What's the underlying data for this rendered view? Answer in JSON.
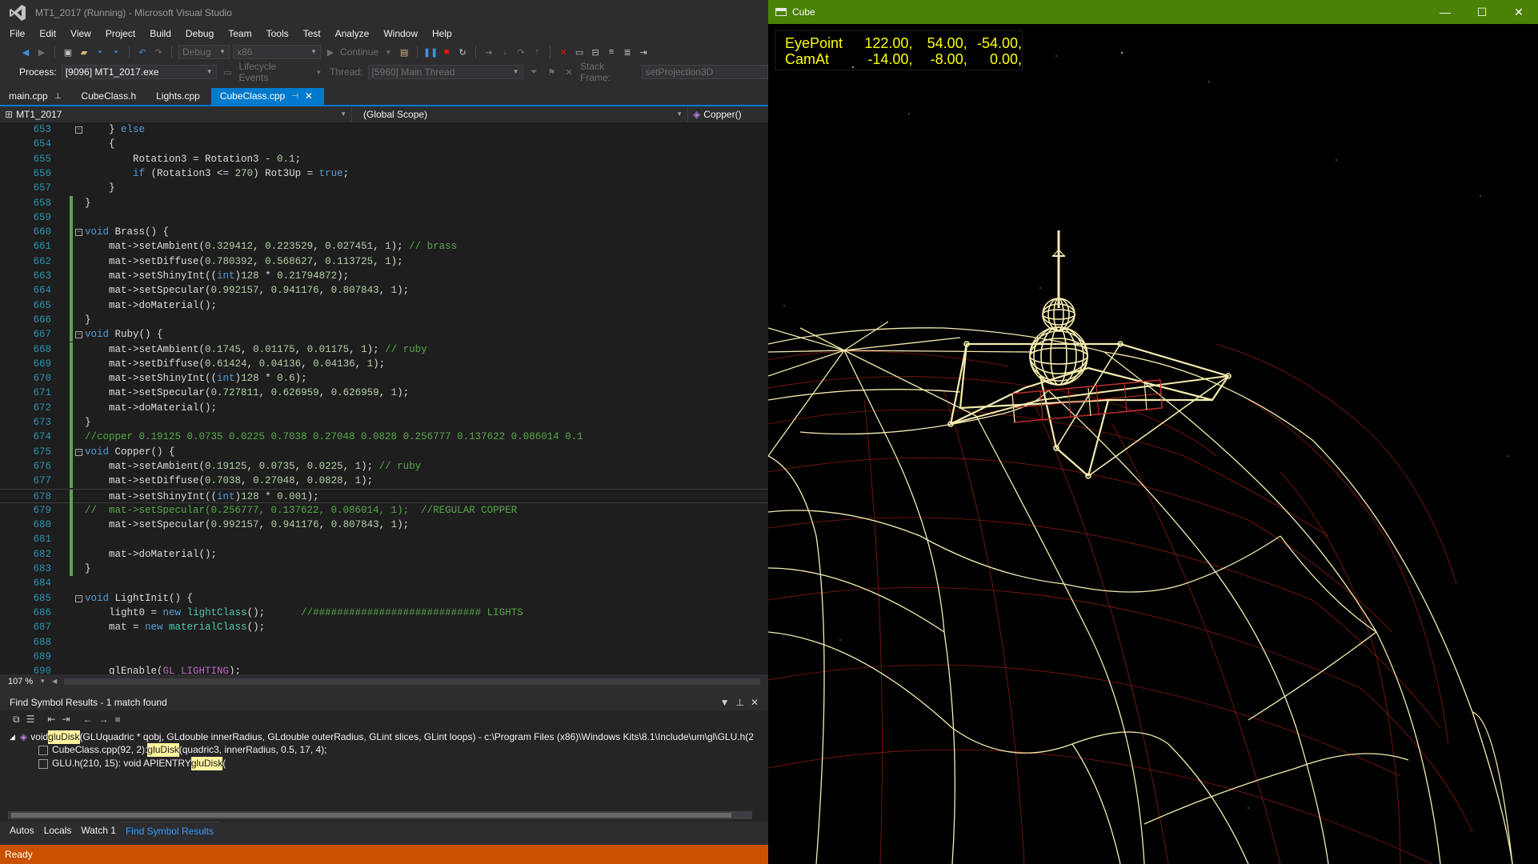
{
  "vs": {
    "window_title": "MT1_2017 (Running) - Microsoft Visual Studio",
    "menu": [
      "File",
      "Edit",
      "View",
      "Project",
      "Build",
      "Debug",
      "Team",
      "Tools",
      "Test",
      "Analyze",
      "Window",
      "Help"
    ],
    "toolbar": {
      "config": "Debug",
      "platform": "x86",
      "continue_label": "Continue"
    },
    "debugbar": {
      "process_label": "Process:",
      "process_value": "[9096] MT1_2017.exe",
      "lifecycle_label": "Lifecycle Events",
      "thread_label": "Thread:",
      "thread_value": "[5960] Main Thread",
      "stackframe_label": "Stack Frame:",
      "stackframe_value": "setProjection3D"
    },
    "tabs": [
      {
        "label": "main.cpp",
        "pinned": true
      },
      {
        "label": "CubeClass.h"
      },
      {
        "label": "Lights.cpp"
      },
      {
        "label": "CubeClass.cpp",
        "active": true,
        "pinned": true
      }
    ],
    "navbar": {
      "project": "MT1_2017",
      "scope": "(Global Scope)",
      "member": "Copper()"
    },
    "zoom": "107 %",
    "code_lines": [
      {
        "n": "653",
        "html": "    } <span class=\"kw\">else</span>"
      },
      {
        "n": "654",
        "html": "    {"
      },
      {
        "n": "655",
        "html": "        Rotation3 = Rotation3 - <span class=\"num\">0.1</span>;"
      },
      {
        "n": "656",
        "html": "        <span class=\"kw\">if</span> (Rotation3 &lt;= <span class=\"num\">270</span>) Rot3Up = <span class=\"kw\">true</span>;"
      },
      {
        "n": "657",
        "html": "    }"
      },
      {
        "n": "658",
        "html": "}"
      },
      {
        "n": "659",
        "html": ""
      },
      {
        "n": "660",
        "html": "<span class=\"kw\">void</span> Brass() {"
      },
      {
        "n": "661",
        "html": "    mat-&gt;setAmbient(<span class=\"num\">0.329412</span>, <span class=\"num\">0.223529</span>, <span class=\"num\">0.027451</span>, <span class=\"num\">1</span>); <span class=\"cm\">// brass</span>"
      },
      {
        "n": "662",
        "html": "    mat-&gt;setDiffuse(<span class=\"num\">0.780392</span>, <span class=\"num\">0.568627</span>, <span class=\"num\">0.113725</span>, <span class=\"num\">1</span>);"
      },
      {
        "n": "663",
        "html": "    mat-&gt;setShinyInt((<span class=\"kw\">int</span>)<span class=\"num\">128</span> * <span class=\"num\">0.21794872</span>);"
      },
      {
        "n": "664",
        "html": "    mat-&gt;setSpecular(<span class=\"num\">0.992157</span>, <span class=\"num\">0.941176</span>, <span class=\"num\">0.807843</span>, <span class=\"num\">1</span>);"
      },
      {
        "n": "665",
        "html": "    mat-&gt;doMaterial();"
      },
      {
        "n": "666",
        "html": "}"
      },
      {
        "n": "667",
        "html": "<span class=\"kw\">void</span> Ruby() {"
      },
      {
        "n": "668",
        "html": "    mat-&gt;setAmbient(<span class=\"num\">0.1745</span>, <span class=\"num\">0.01175</span>, <span class=\"num\">0.01175</span>, <span class=\"num\">1</span>); <span class=\"cm\">// ruby</span>"
      },
      {
        "n": "669",
        "html": "    mat-&gt;setDiffuse(<span class=\"num\">0.61424</span>, <span class=\"num\">0.04136</span>, <span class=\"num\">0.04136</span>, <span class=\"num\">1</span>);"
      },
      {
        "n": "670",
        "html": "    mat-&gt;setShinyInt((<span class=\"kw\">int</span>)<span class=\"num\">128</span> * <span class=\"num\">0.6</span>);"
      },
      {
        "n": "671",
        "html": "    mat-&gt;setSpecular(<span class=\"num\">0.727811</span>, <span class=\"num\">0.626959</span>, <span class=\"num\">0.626959</span>, <span class=\"num\">1</span>);"
      },
      {
        "n": "672",
        "html": "    mat-&gt;doMaterial();"
      },
      {
        "n": "673",
        "html": "}"
      },
      {
        "n": "674",
        "html": "<span class=\"cm\">//copper 0.19125 0.0735 0.0225 0.7038 0.27048 0.0828 0.256777 0.137622 0.086014 0.1</span>"
      },
      {
        "n": "675",
        "html": "<span class=\"kw\">void</span> Copper() {"
      },
      {
        "n": "676",
        "html": "    mat-&gt;setAmbient(<span class=\"num\">0.19125</span>, <span class=\"num\">0.0735</span>, <span class=\"num\">0.0225</span>, <span class=\"num\">1</span>); <span class=\"cm\">// ruby</span>"
      },
      {
        "n": "677",
        "html": "    mat-&gt;setDiffuse(<span class=\"num\">0.7038</span>, <span class=\"num\">0.27048</span>, <span class=\"num\">0.0828</span>, <span class=\"num\">1</span>);"
      },
      {
        "n": "678",
        "html": "    mat-&gt;setShinyInt((<span class=\"kw\">int</span>)<span class=\"num\">128</span> * <span class=\"num\">0.001</span>);"
      },
      {
        "n": "679",
        "html": "<span class=\"cm\">//  mat-&gt;setSpecular(0.256777, 0.137622, 0.086014, 1);  //REGULAR COPPER</span>"
      },
      {
        "n": "680",
        "html": "    mat-&gt;setSpecular(<span class=\"num\">0.992157</span>, <span class=\"num\">0.941176</span>, <span class=\"num\">0.807843</span>, <span class=\"num\">1</span>);"
      },
      {
        "n": "681",
        "html": ""
      },
      {
        "n": "682",
        "html": "    mat-&gt;doMaterial();"
      },
      {
        "n": "683",
        "html": "}"
      },
      {
        "n": "684",
        "html": ""
      },
      {
        "n": "685",
        "html": "<span class=\"kw\">void</span> LightInit() {"
      },
      {
        "n": "686",
        "html": "    light0 = <span class=\"kw\">new</span> <span class=\"ty\">lightClass</span>();      <span class=\"cm\">//############################ LIGHTS</span>"
      },
      {
        "n": "687",
        "html": "    mat = <span class=\"kw\">new</span> <span class=\"ty\">materialClass</span>();"
      },
      {
        "n": "688",
        "html": ""
      },
      {
        "n": "689",
        "html": ""
      },
      {
        "n": "690",
        "html": "    glEnable(<span class=\"mac\">GL_LIGHTING</span>);"
      }
    ],
    "find_panel": {
      "title": "Find Symbol Results - 1 match found",
      "row1_pre": "void ",
      "row1_hl": "gluDisk",
      "row1_post": "(GLUquadric * qobj, GLdouble innerRadius, GLdouble outerRadius, GLint slices, GLint loops) - c:\\Program Files (x86)\\Windows Kits\\8.1\\Include\\um\\gl\\GLU.h(2",
      "row2_pre": "CubeClass.cpp(92, 2): ",
      "row2_hl": "gluDisk",
      "row2_post": "(quadric3, innerRadius, 0.5, 17, 4);",
      "row3_pre": "GLU.h(210, 15): void APIENTRY ",
      "row3_hl": "gluDisk",
      "row3_post": "("
    },
    "bottom_tabs": [
      "Autos",
      "Locals",
      "Watch 1",
      "Find Symbol Results"
    ],
    "status": "Ready"
  },
  "cube": {
    "window_title": "Cube",
    "hud": {
      "eye_label": "EyePoint",
      "eye": [
        "122.00,",
        "54.00,",
        "-54.00,"
      ],
      "at_label": "CamAt",
      "at": [
        "-14.00,",
        "-8.00,",
        "0.00,"
      ]
    },
    "colors": {
      "wire": "#f5edb0",
      "grid_red": "#8a1a10",
      "panel_red": "#d03030",
      "hud_text": "#ffff00",
      "titlebar": "#498205"
    }
  }
}
